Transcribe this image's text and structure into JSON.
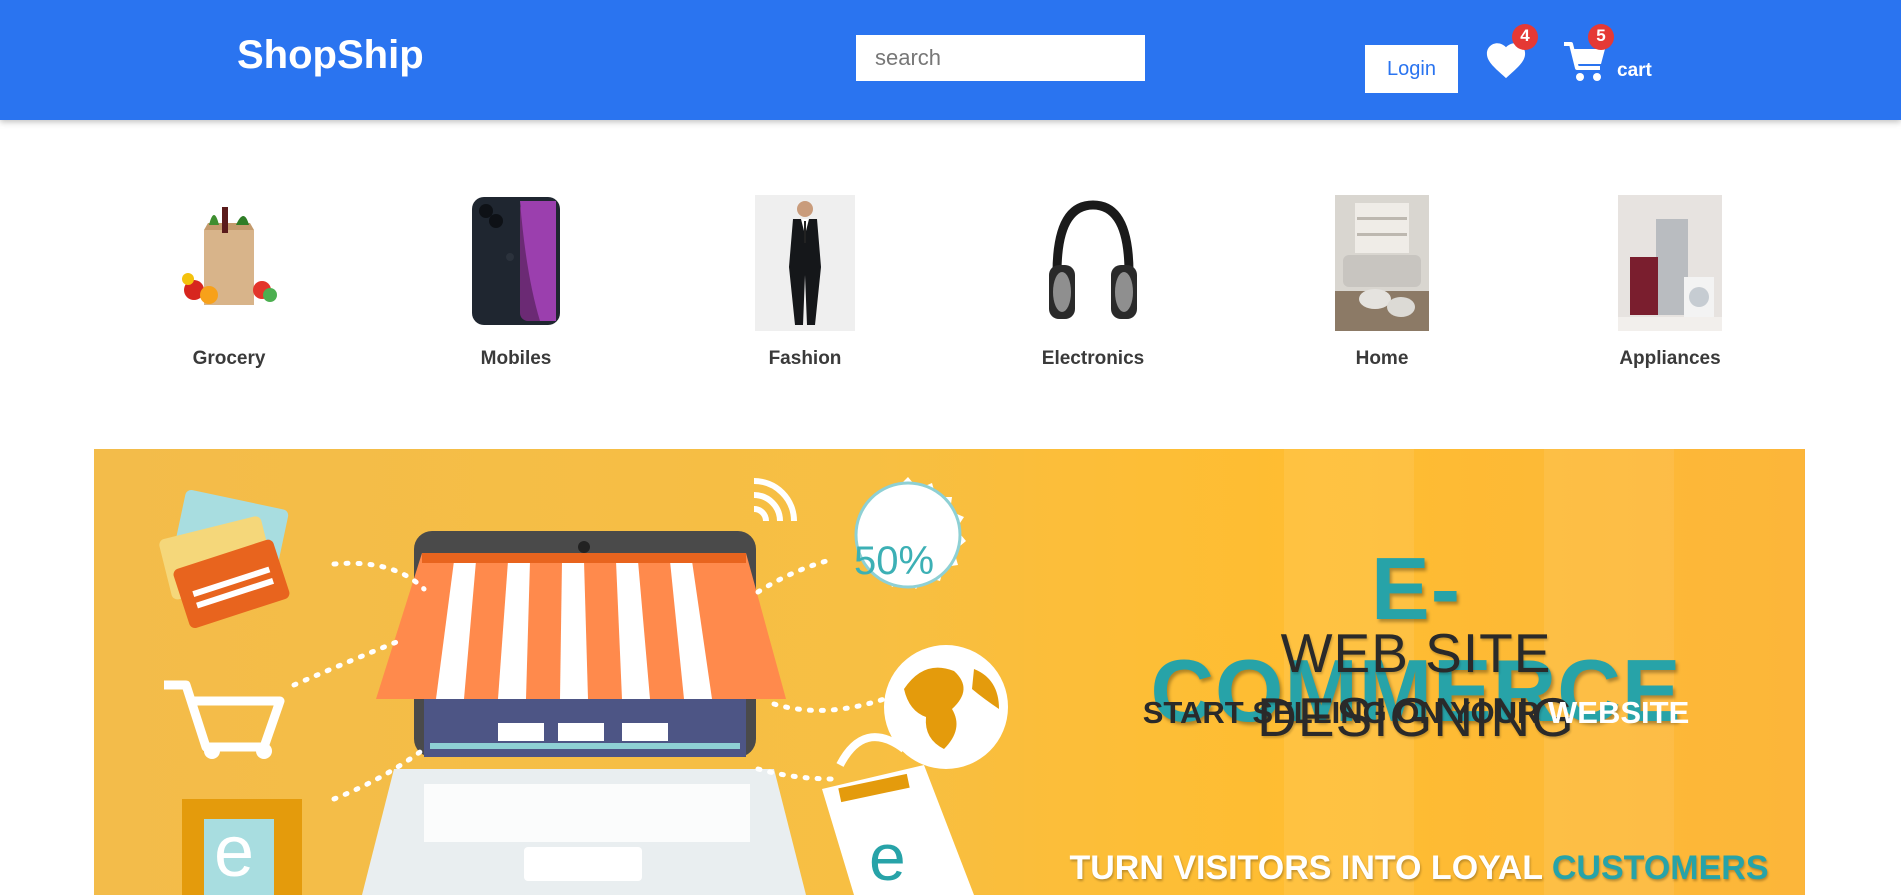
{
  "header": {
    "logo": "ShopShip",
    "search_placeholder": "search",
    "login_label": "Login",
    "wishlist_count": "4",
    "cart_count": "5",
    "cart_label": "cart"
  },
  "categories": [
    {
      "label": "Grocery",
      "icon": "grocery-bag-image"
    },
    {
      "label": "Mobiles",
      "icon": "smartphone-image"
    },
    {
      "label": "Fashion",
      "icon": "suit-man-image"
    },
    {
      "label": "Electronics",
      "icon": "headphones-image"
    },
    {
      "label": "Home",
      "icon": "living-room-image"
    },
    {
      "label": "Appliances",
      "icon": "appliances-image"
    }
  ],
  "banner": {
    "discount": "50%",
    "title": "E-COMMERCE",
    "subtitle": "WEB SITE DESIGNING",
    "line3_a": "START SELLING ON YOUR",
    "line3_b": "WEBSITE",
    "line4_a": "TURN VISITORS INTO LOYAL",
    "line4_b": "CUSTOMERS",
    "letter": "e"
  },
  "colors": {
    "header_bg": "#2a74f0",
    "badge": "#e53935",
    "banner_accent": "#27a3a8",
    "banner_bg": "#f7bf43"
  }
}
